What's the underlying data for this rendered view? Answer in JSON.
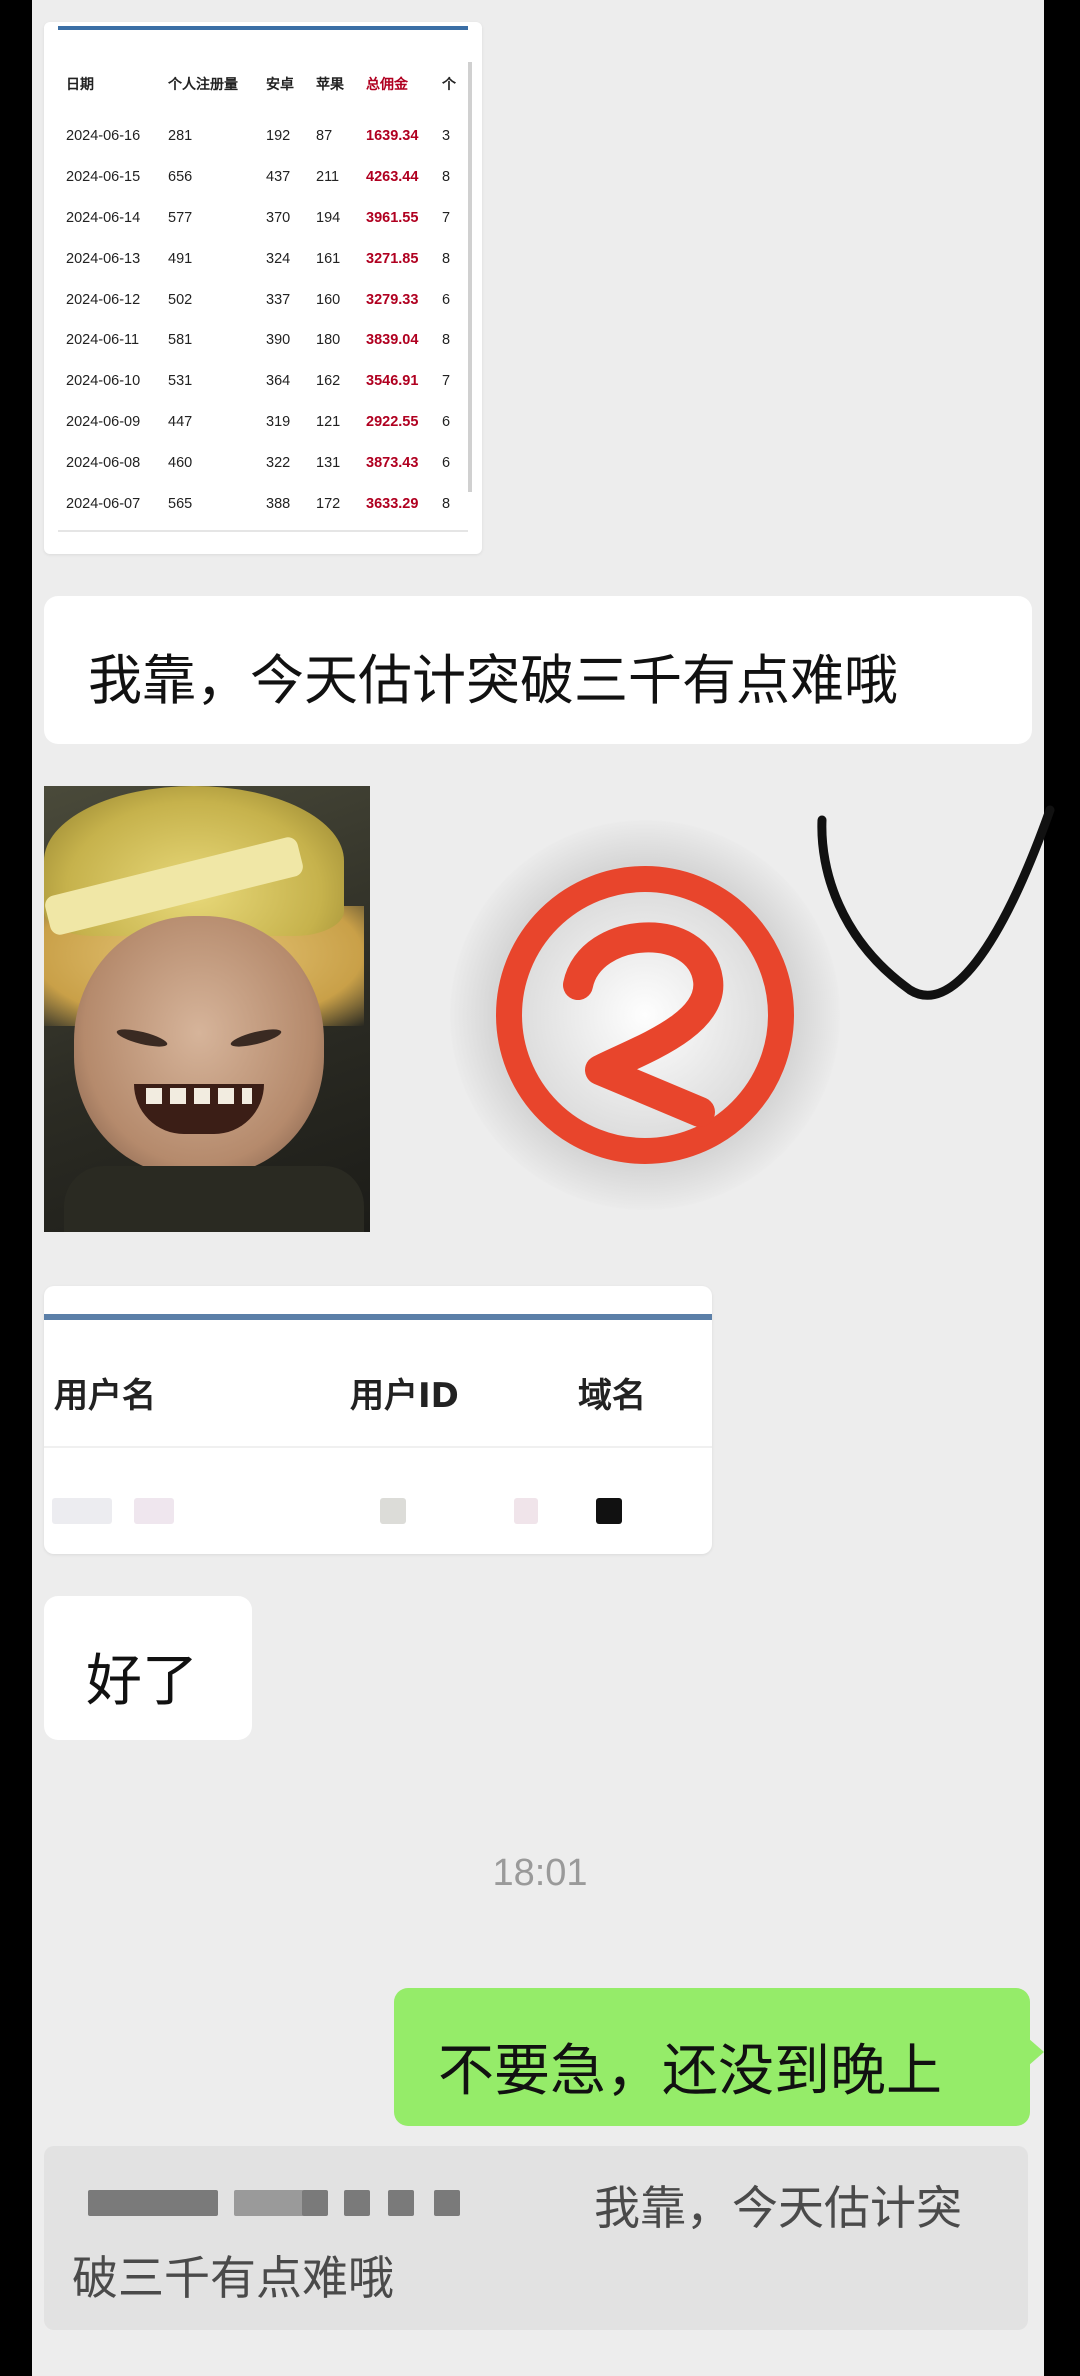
{
  "stats_table": {
    "headers": [
      "日期",
      "个人注册量",
      "安卓",
      "苹果",
      "总佣金",
      "个"
    ],
    "rows": [
      [
        "2024-06-16",
        "281",
        "192",
        "87",
        "1639.34",
        "3"
      ],
      [
        "2024-06-15",
        "656",
        "437",
        "211",
        "4263.44",
        "8"
      ],
      [
        "2024-06-14",
        "577",
        "370",
        "194",
        "3961.55",
        "7"
      ],
      [
        "2024-06-13",
        "491",
        "324",
        "161",
        "3271.85",
        "8"
      ],
      [
        "2024-06-12",
        "502",
        "337",
        "160",
        "3279.33",
        "6"
      ],
      [
        "2024-06-11",
        "581",
        "390",
        "180",
        "3839.04",
        "8"
      ],
      [
        "2024-06-10",
        "531",
        "364",
        "162",
        "3546.91",
        "7"
      ],
      [
        "2024-06-09",
        "447",
        "319",
        "121",
        "2922.55",
        "6"
      ],
      [
        "2024-06-08",
        "460",
        "322",
        "131",
        "3873.43",
        "6"
      ],
      [
        "2024-06-07",
        "565",
        "388",
        "172",
        "3633.29",
        "8"
      ]
    ]
  },
  "messages": {
    "msg1": "我靠，今天估计突破三千有点难哦",
    "msg2": "好了",
    "timestamp": "18:01",
    "msg3": "不要急，还没到晚上"
  },
  "sticker": {
    "icon": "number-2-icon",
    "color": "#e8452c"
  },
  "user_table": {
    "col_user": "用户名",
    "col_uid": "用户ID",
    "col_domain": "域名"
  },
  "quote": {
    "line1": "我靠，今天估计突",
    "line2": "破三千有点难哦"
  },
  "colors": {
    "chat_bg": "#ededed",
    "sent_bubble": "#95ec69",
    "received_bubble": "#ffffff",
    "commission_red": "#b00020"
  }
}
